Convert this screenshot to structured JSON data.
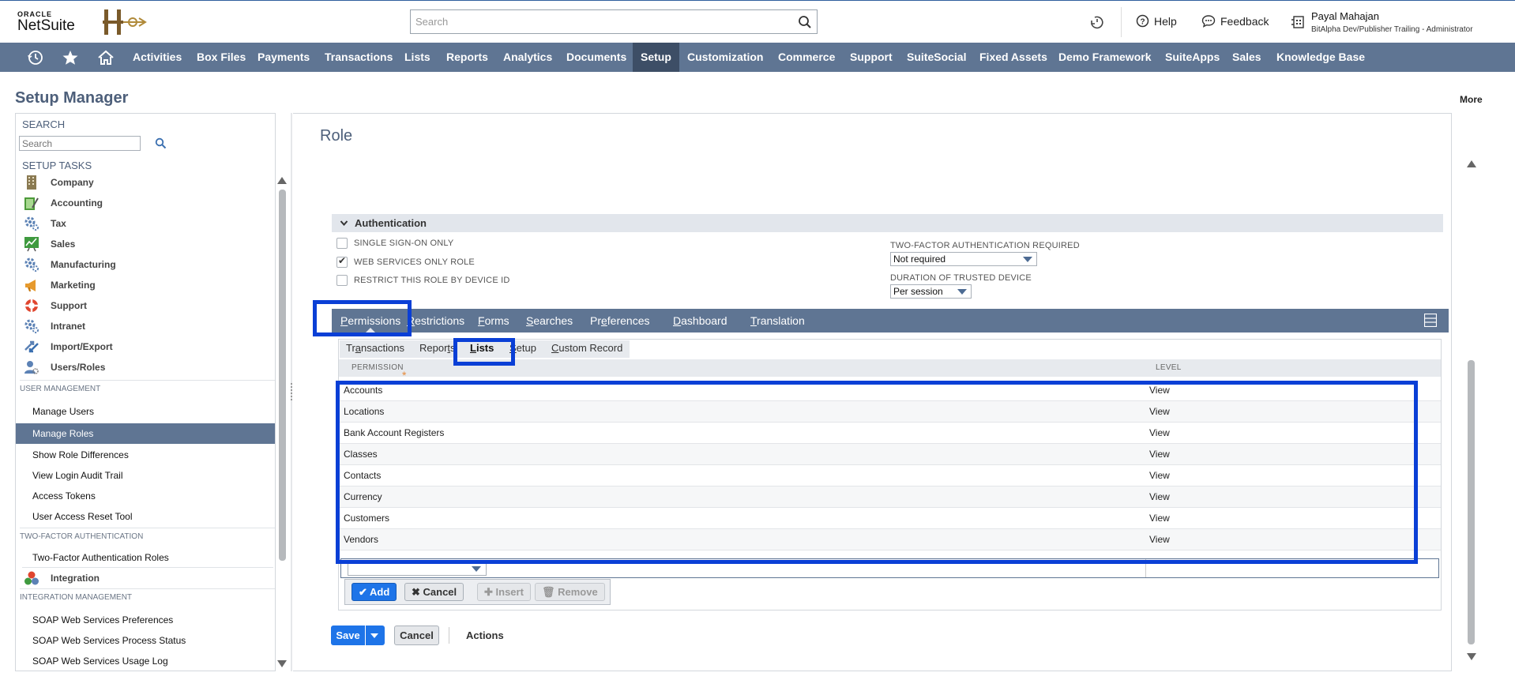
{
  "header": {
    "logo_top": "ORACLE",
    "logo_bottom": "NetSuite",
    "search_placeholder": "Search",
    "help": "Help",
    "feedback": "Feedback",
    "user_name": "Payal Mahajan",
    "user_role": "BitAlpha Dev/Publisher Trailing - Administrator"
  },
  "nav": {
    "items": [
      "Activities",
      "Box Files",
      "Payments",
      "Transactions",
      "Lists",
      "Reports",
      "Analytics",
      "Documents",
      "Setup",
      "Customization",
      "Commerce",
      "Support",
      "SuiteSocial",
      "Fixed Assets",
      "Demo Framework",
      "SuiteApps",
      "Sales",
      "Knowledge Base"
    ],
    "active": "Setup"
  },
  "page": {
    "title": "Setup Manager",
    "more": "More"
  },
  "left": {
    "search_label": "SEARCH",
    "search_placeholder": "Search",
    "tasks_label": "SETUP TASKS",
    "tasks": [
      "Company",
      "Accounting",
      "Tax",
      "Sales",
      "Manufacturing",
      "Marketing",
      "Support",
      "Intranet",
      "Import/Export",
      "Users/Roles"
    ],
    "user_mgmt_label": "USER MANAGEMENT",
    "user_mgmt": [
      "Manage Users",
      "Manage Roles",
      "Show Role Differences",
      "View Login Audit Trail",
      "Access Tokens",
      "User Access Reset Tool"
    ],
    "twofa_label": "TWO-FACTOR AUTHENTICATION",
    "twofa": [
      "Two-Factor Authentication Roles"
    ],
    "integration": "Integration",
    "integ_mgmt_label": "INTEGRATION MANAGEMENT",
    "integ_mgmt": [
      "SOAP Web Services Preferences",
      "SOAP Web Services Process Status",
      "SOAP Web Services Usage Log"
    ]
  },
  "role": {
    "title": "Role",
    "auth_section": "Authentication",
    "sso": "SINGLE SIGN-ON ONLY",
    "web_services": "WEB SERVICES ONLY ROLE",
    "device": "RESTRICT THIS ROLE BY DEVICE ID",
    "twofa_label": "TWO-FACTOR AUTHENTICATION REQUIRED",
    "twofa_value": "Not required",
    "trusted_label": "DURATION OF TRUSTED DEVICE",
    "trusted_value": "Per session"
  },
  "tabs": {
    "main": [
      {
        "u": "P",
        "rest": "ermissions"
      },
      {
        "u": "R",
        "rest": "estrictions"
      },
      {
        "u": "F",
        "rest": "orms"
      },
      {
        "u": "S",
        "rest": "earches"
      },
      {
        "u": "",
        "pre": "Pr",
        "mid": "e",
        "rest": "ferences"
      },
      {
        "u": "D",
        "rest": "ashboard"
      },
      {
        "u": "T",
        "rest": "ranslation"
      }
    ],
    "sub": [
      {
        "pre": "Tr",
        "u": "a",
        "rest": "nsactions"
      },
      {
        "pre": "Repor",
        "u": "t",
        "rest": "s"
      },
      {
        "pre": "",
        "u": "L",
        "rest": "ists"
      },
      {
        "pre": "",
        "u": "S",
        "rest": "etup"
      },
      {
        "pre": "",
        "u": "C",
        "rest": "ustom Record"
      }
    ]
  },
  "grid": {
    "col_permission": "PERMISSION",
    "col_level": "LEVEL",
    "rows": [
      {
        "permission": "Accounts",
        "level": "View"
      },
      {
        "permission": "Locations",
        "level": "View"
      },
      {
        "permission": "Bank Account Registers",
        "level": "View"
      },
      {
        "permission": "Classes",
        "level": "View"
      },
      {
        "permission": "Contacts",
        "level": "View"
      },
      {
        "permission": "Currency",
        "level": "View"
      },
      {
        "permission": "Customers",
        "level": "View"
      },
      {
        "permission": "Vendors",
        "level": "View"
      }
    ],
    "add": "Add",
    "cancel": "Cancel",
    "insert": "Insert",
    "remove": "Remove"
  },
  "footer": {
    "save": "Save",
    "cancel": "Cancel",
    "actions": "Actions"
  },
  "colors": {
    "nav": "#5f7593",
    "nav_active": "#3d4e66",
    "primary": "#1e74e8",
    "highlight": "#0a3fd6"
  }
}
